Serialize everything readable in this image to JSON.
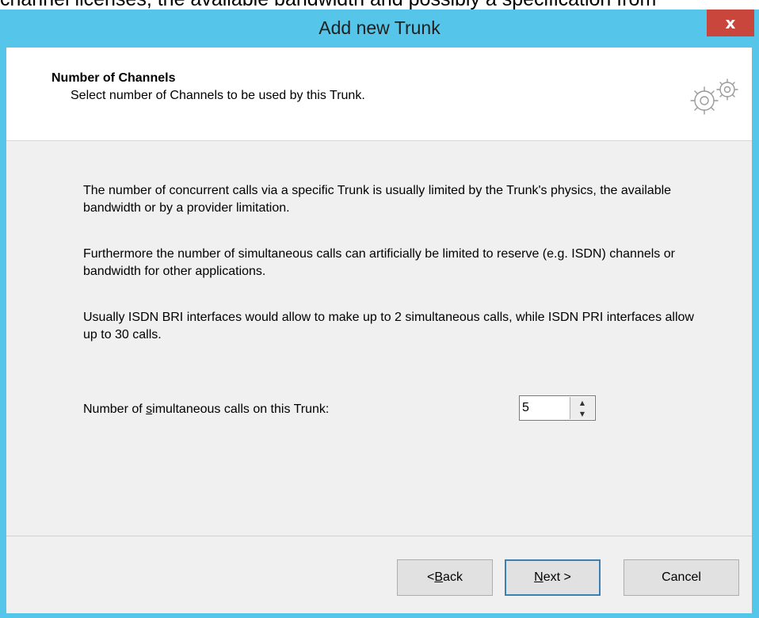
{
  "background_text": "channel licenses, the available bandwidth and possibly a specification from",
  "window": {
    "title": "Add new Trunk",
    "close_label": "x"
  },
  "header": {
    "title": "Number of Channels",
    "subtitle": "Select number of Channels to be used by this Trunk.",
    "icon": "gears-icon"
  },
  "body": {
    "paragraphs": [
      "The number of concurrent calls via a specific Trunk is usually limited by the Trunk's physics, the available bandwidth or by a provider limitation.",
      "Furthermore the number of simultaneous calls can artificially be limited to reserve (e.g. ISDN) channels or bandwidth for other applications.",
      "Usually ISDN BRI interfaces would allow to make up to 2 simultaneous calls, while ISDN PRI interfaces allow up to 30 calls."
    ],
    "field_label_pre": "Number of ",
    "field_label_mnemonic": "s",
    "field_label_post": "imultaneous calls on this Trunk:",
    "field_value": "5"
  },
  "buttons": {
    "back_pre": "< ",
    "back_mnemonic": "B",
    "back_post": "ack",
    "next_mnemonic": "N",
    "next_post": "ext >",
    "cancel": "Cancel"
  },
  "colors": {
    "titlebar": "#55c6e9",
    "close": "#c9463d",
    "dialog_bg": "#f0f0f0"
  }
}
